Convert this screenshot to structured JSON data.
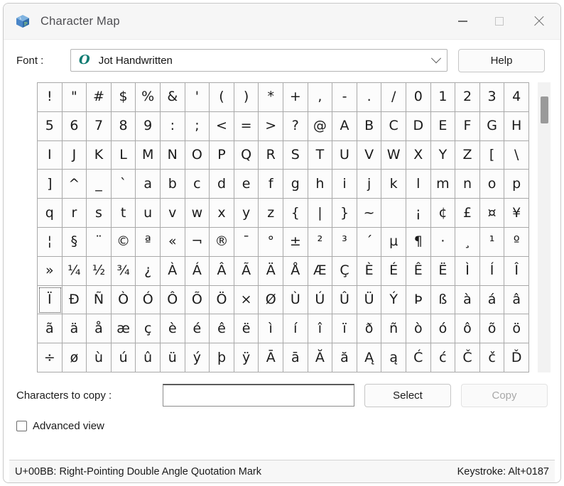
{
  "window": {
    "title": "Character Map",
    "icon": "character-map-icon",
    "controls": {
      "minimize": "minimize-icon",
      "maximize": "maximize-icon",
      "close": "close-icon"
    }
  },
  "font_row": {
    "label": "Font :",
    "preview_glyph": "O",
    "selected_font": "Jot Handwritten",
    "dropdown_icon": "chevron-down-icon",
    "help_label": "Help"
  },
  "grid": {
    "columns": 20,
    "rows": 10,
    "selected_index": 140,
    "cells": [
      "!",
      "\"",
      "#",
      "$",
      "%",
      "&",
      "'",
      "(",
      ")",
      "*",
      "+",
      ",",
      "-",
      ".",
      "/",
      "0",
      "1",
      "2",
      "3",
      "4",
      "5",
      "6",
      "7",
      "8",
      "9",
      ":",
      ";",
      "<",
      "=",
      ">",
      "?",
      "@",
      "A",
      "B",
      "C",
      "D",
      "E",
      "F",
      "G",
      "H",
      "I",
      "J",
      "K",
      "L",
      "M",
      "N",
      "O",
      "P",
      "Q",
      "R",
      "S",
      "T",
      "U",
      "V",
      "W",
      "X",
      "Y",
      "Z",
      "[",
      "\\",
      "]",
      "^",
      "_",
      "`",
      "a",
      "b",
      "c",
      "d",
      "e",
      "f",
      "g",
      "h",
      "i",
      "j",
      "k",
      "l",
      "m",
      "n",
      "o",
      "p",
      "q",
      "r",
      "s",
      "t",
      "u",
      "v",
      "w",
      "x",
      "y",
      "z",
      "{",
      "|",
      "}",
      "~",
      " ",
      "¡",
      "¢",
      "£",
      "¤",
      "¥",
      "¦",
      "§",
      "¨",
      "©",
      "ª",
      "«",
      "¬",
      "®",
      "¯",
      "°",
      "±",
      "²",
      "³",
      "´",
      "µ",
      "¶",
      "·",
      "¸",
      "¹",
      "º",
      "»",
      "¼",
      "½",
      "¾",
      "¿",
      "À",
      "Á",
      "Â",
      "Ã",
      "Ä",
      "Å",
      "Æ",
      "Ç",
      "È",
      "É",
      "Ê",
      "Ë",
      "Ì",
      "Í",
      "Î",
      "Ï",
      "Ð",
      "Ñ",
      "Ò",
      "Ó",
      "Ô",
      "Õ",
      "Ö",
      "×",
      "Ø",
      "Ù",
      "Ú",
      "Û",
      "Ü",
      "Ý",
      "Þ",
      "ß",
      "à",
      "á",
      "â",
      "ã",
      "ä",
      "å",
      "æ",
      "ç",
      "è",
      "é",
      "ê",
      "ë",
      "ì",
      "í",
      "î",
      "ï",
      "ð",
      "ñ",
      "ò",
      "ó",
      "ô",
      "õ",
      "ö",
      "÷",
      "ø",
      "ù",
      "ú",
      "û",
      "ü",
      "ý",
      "þ",
      "ÿ",
      "Ā",
      "ā",
      "Ă",
      "ă",
      "Ą",
      "ą",
      "Ć",
      "ć",
      "Č",
      "č",
      "Ď"
    ],
    "scrollbar": {
      "name": "vertical-scrollbar",
      "thumb": "scrollbar-thumb"
    }
  },
  "copy_row": {
    "label": "Characters to copy :",
    "input_value": "",
    "input_placeholder": "",
    "select_label": "Select",
    "copy_label": "Copy"
  },
  "advanced": {
    "label": "Advanced view",
    "checked": false
  },
  "status": {
    "left": "U+00BB: Right-Pointing Double Angle Quotation Mark",
    "right": "Keystroke: Alt+0187"
  },
  "colors": {
    "titlebar_bg": "#f6f6f6",
    "grid_border": "#a9a9a9",
    "accent_glyph": "#0f7b72",
    "scroll_thumb": "#9a9a9a"
  }
}
